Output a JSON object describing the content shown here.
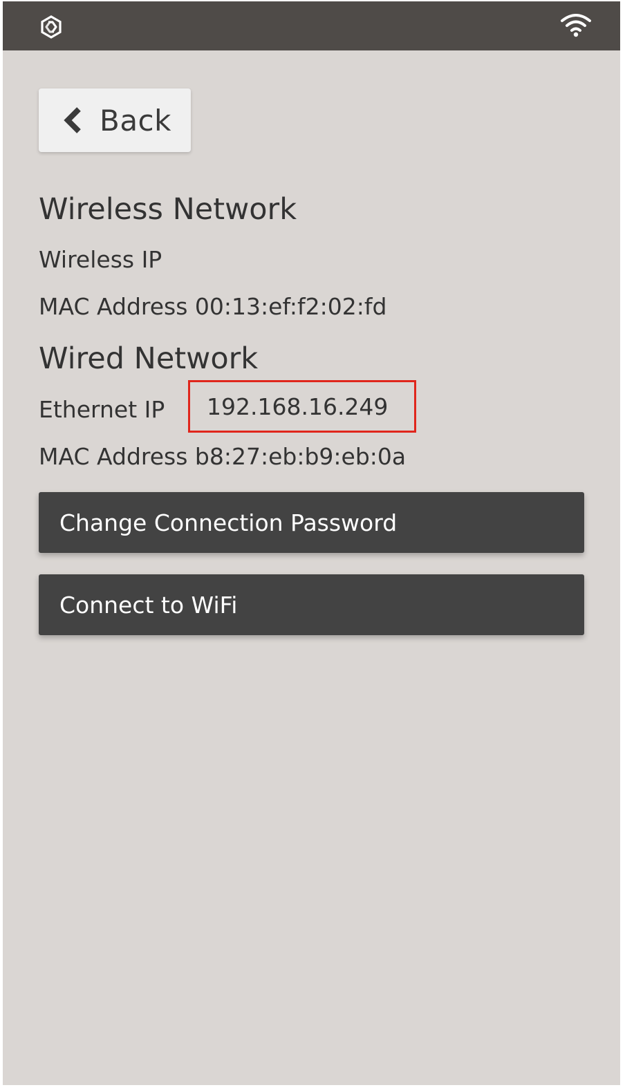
{
  "header": {
    "logo_icon": "hexagon-logo-icon",
    "wifi_icon": "wifi-icon",
    "bar_color": "#4f4b48"
  },
  "back": {
    "icon": "chevron-left-icon",
    "label": "Back"
  },
  "wireless": {
    "title": "Wireless Network",
    "ip_label": "Wireless IP",
    "mac_label": "MAC Address",
    "mac_value": "00:13:ef:f2:02:fd"
  },
  "wired": {
    "title": "Wired Network",
    "ip_label": "Ethernet IP",
    "ip_value": "192.168.16.249",
    "mac_label": "MAC Address",
    "mac_value": "b8:27:eb:b9:eb:0a"
  },
  "actions": {
    "change_password": "Change Connection Password",
    "connect_wifi": "Connect to WiFi"
  },
  "colors": {
    "background": "#dad6d3",
    "button_dark": "#434343",
    "highlight_box": "#e0261c"
  }
}
